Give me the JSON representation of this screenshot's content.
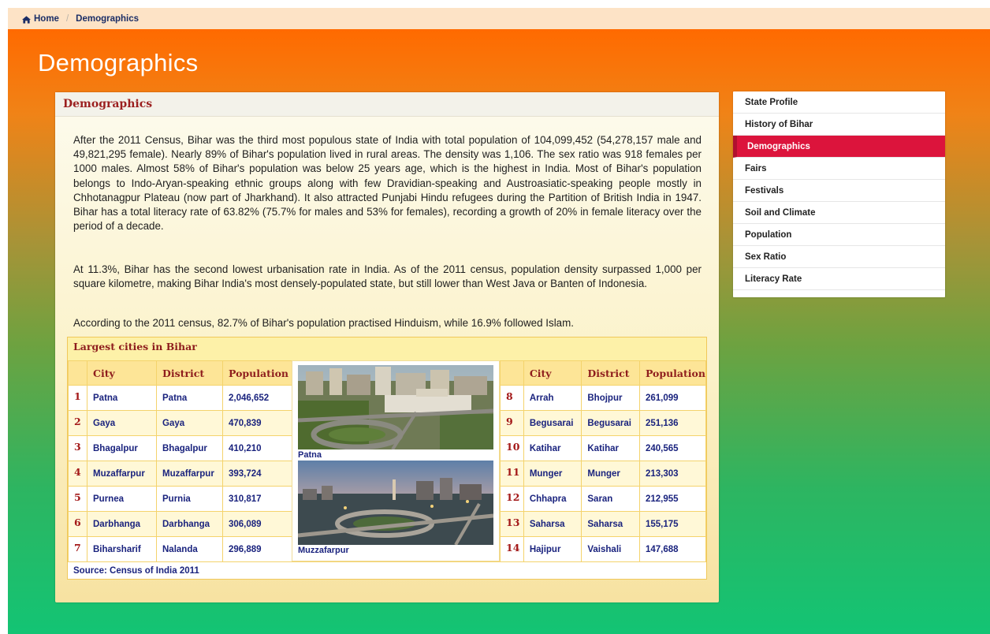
{
  "breadcrumb": {
    "home": "Home",
    "current": "Demographics"
  },
  "page": {
    "title": "Demographics"
  },
  "card": {
    "title": "Demographics",
    "paragraphs": [
      "After the 2011 Census, Bihar was the third most populous state of India with total population of 104,099,452 (54,278,157 male and 49,821,295 female). Nearly 89% of Bihar's population lived in rural areas. The density was 1,106. The sex ratio was 918 females per 1000 males. Almost 58% of Bihar's population was below 25 years age, which is the highest in India. Most of Bihar's population belongs to Indo-Aryan-speaking ethnic groups along with few Dravidian-speaking and Austroasiatic-speaking people mostly in Chhotanagpur Plateau (now part of Jharkhand). It also attracted Punjabi Hindu refugees during the Partition of British India in 1947. Bihar has a total literacy rate of 63.82% (75.7% for males and 53% for females), recording a growth of 20% in female literacy over the period of a decade.",
      "At 11.3%, Bihar has the second lowest urbanisation rate in India. As of the 2011 census, population density surpassed 1,000 per square kilometre, making Bihar India's most densely-populated state, but still lower than West Java or Banten of Indonesia.",
      "According to the 2011 census, 82.7% of Bihar's population practised Hinduism, while 16.9% followed Islam."
    ]
  },
  "cities": {
    "title": "Largest cities in Bihar",
    "headers": {
      "city": "City",
      "district": "District",
      "population": "Population"
    },
    "left": [
      {
        "rank": "1",
        "city": "Patna",
        "district": "Patna",
        "population": "2,046,652"
      },
      {
        "rank": "2",
        "city": "Gaya",
        "district": "Gaya",
        "population": "470,839"
      },
      {
        "rank": "3",
        "city": "Bhagalpur",
        "district": "Bhagalpur",
        "population": "410,210"
      },
      {
        "rank": "4",
        "city": "Muzaffarpur",
        "district": "Muzaffarpur",
        "population": "393,724"
      },
      {
        "rank": "5",
        "city": "Purnea",
        "district": "Purnia",
        "population": "310,817"
      },
      {
        "rank": "6",
        "city": "Darbhanga",
        "district": "Darbhanga",
        "population": "306,089"
      },
      {
        "rank": "7",
        "city": "Biharsharif",
        "district": "Nalanda",
        "population": "296,889"
      }
    ],
    "right": [
      {
        "rank": "8",
        "city": "Arrah",
        "district": "Bhojpur",
        "population": "261,099"
      },
      {
        "rank": "9",
        "city": "Begusarai",
        "district": "Begusarai",
        "population": "251,136"
      },
      {
        "rank": "10",
        "city": "Katihar",
        "district": "Katihar",
        "population": "240,565"
      },
      {
        "rank": "11",
        "city": "Munger",
        "district": "Munger",
        "population": "213,303"
      },
      {
        "rank": "12",
        "city": "Chhapra",
        "district": "Saran",
        "population": "212,955"
      },
      {
        "rank": "13",
        "city": "Saharsa",
        "district": "Saharsa",
        "population": "155,175"
      },
      {
        "rank": "14",
        "city": "Hajipur",
        "district": "Vaishali",
        "population": "147,688"
      }
    ],
    "photos": [
      {
        "caption": "Patna"
      },
      {
        "caption": "Muzzafarpur"
      }
    ],
    "source": "Source: Census of India 2011"
  },
  "sidebar": {
    "items": [
      {
        "label": "State Profile",
        "active": false
      },
      {
        "label": "History of Bihar",
        "active": false
      },
      {
        "label": "Demographics",
        "active": true
      },
      {
        "label": "Fairs",
        "active": false
      },
      {
        "label": "Festivals",
        "active": false
      },
      {
        "label": "Soil and Climate",
        "active": false
      },
      {
        "label": "Population",
        "active": false
      },
      {
        "label": "Sex Ratio",
        "active": false
      },
      {
        "label": "Literacy Rate",
        "active": false
      }
    ]
  },
  "colors": {
    "accent_active": "#dc143c",
    "heading_red": "#9b1f1f",
    "link_navy": "#1a237e",
    "gradient_top": "#ff6a00",
    "gradient_bottom": "#13c474"
  }
}
